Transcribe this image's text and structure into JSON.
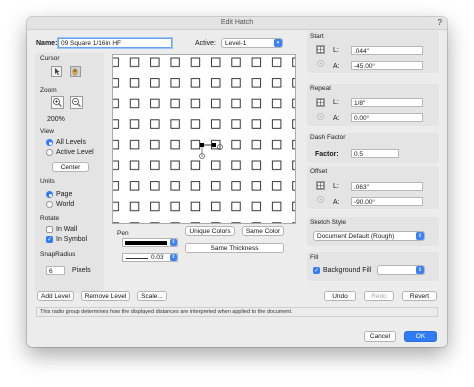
{
  "window": {
    "title": "Edit Hatch",
    "help": "?"
  },
  "name": {
    "label": "Name:",
    "value": "09 Square 1/16in HF"
  },
  "active": {
    "label": "Active:",
    "value": "Level-1"
  },
  "cursor": {
    "label": "Cursor"
  },
  "zoom": {
    "label": "Zoom",
    "value": "200%"
  },
  "view": {
    "label": "View",
    "all_levels": "All Levels",
    "active_level": "Active Level",
    "center": "Center",
    "selected": "all_levels"
  },
  "units": {
    "label": "Units",
    "page": "Page",
    "world": "World",
    "selected": "page"
  },
  "rotate": {
    "label": "Rotate",
    "in_wall": "In Wall",
    "in_symbol": "In Symbol",
    "in_wall_checked": false,
    "in_symbol_checked": true
  },
  "snap_radius": {
    "label": "SnapRadius",
    "value": "6",
    "unit": "Pixels"
  },
  "pen": {
    "label": "Pen",
    "weight": "0.03",
    "unique_colors": "Unique Colors",
    "same_color": "Same Color",
    "same_thickness": "Same Thickness"
  },
  "start": {
    "label": "Start",
    "l_label": "L:",
    "l_value": ".044\"",
    "a_label": "A:",
    "a_value": "-45.00°"
  },
  "repeat": {
    "label": "Repeat",
    "l_label": "L:",
    "l_value": "1/8\"",
    "a_label": "A:",
    "a_value": "0.00°"
  },
  "dash": {
    "label": "Dash Factor",
    "factor_label": "Factor:",
    "factor_value": "0.5"
  },
  "offset": {
    "label": "Offset",
    "l_label": "L:",
    "l_value": ".063\"",
    "a_label": "A:",
    "a_value": "-90.00°"
  },
  "sketch": {
    "label": "Sketch Style",
    "value": "Document Default (Rough)"
  },
  "fill": {
    "label": "Fill",
    "background_fill": "Background Fill",
    "checked": true
  },
  "bottom": {
    "add_level": "Add Level",
    "remove_level": "Remove Level",
    "scale": "Scale...",
    "undo": "Undo",
    "redo": "Redo",
    "revert": "Revert"
  },
  "status": "This radio group determines how the displayed distances are interpreted when applied to the document.",
  "footer": {
    "cancel": "Cancel",
    "ok": "OK"
  },
  "colors": {
    "accent": "#2f7cf6",
    "dialog_bg": "#ececec"
  }
}
